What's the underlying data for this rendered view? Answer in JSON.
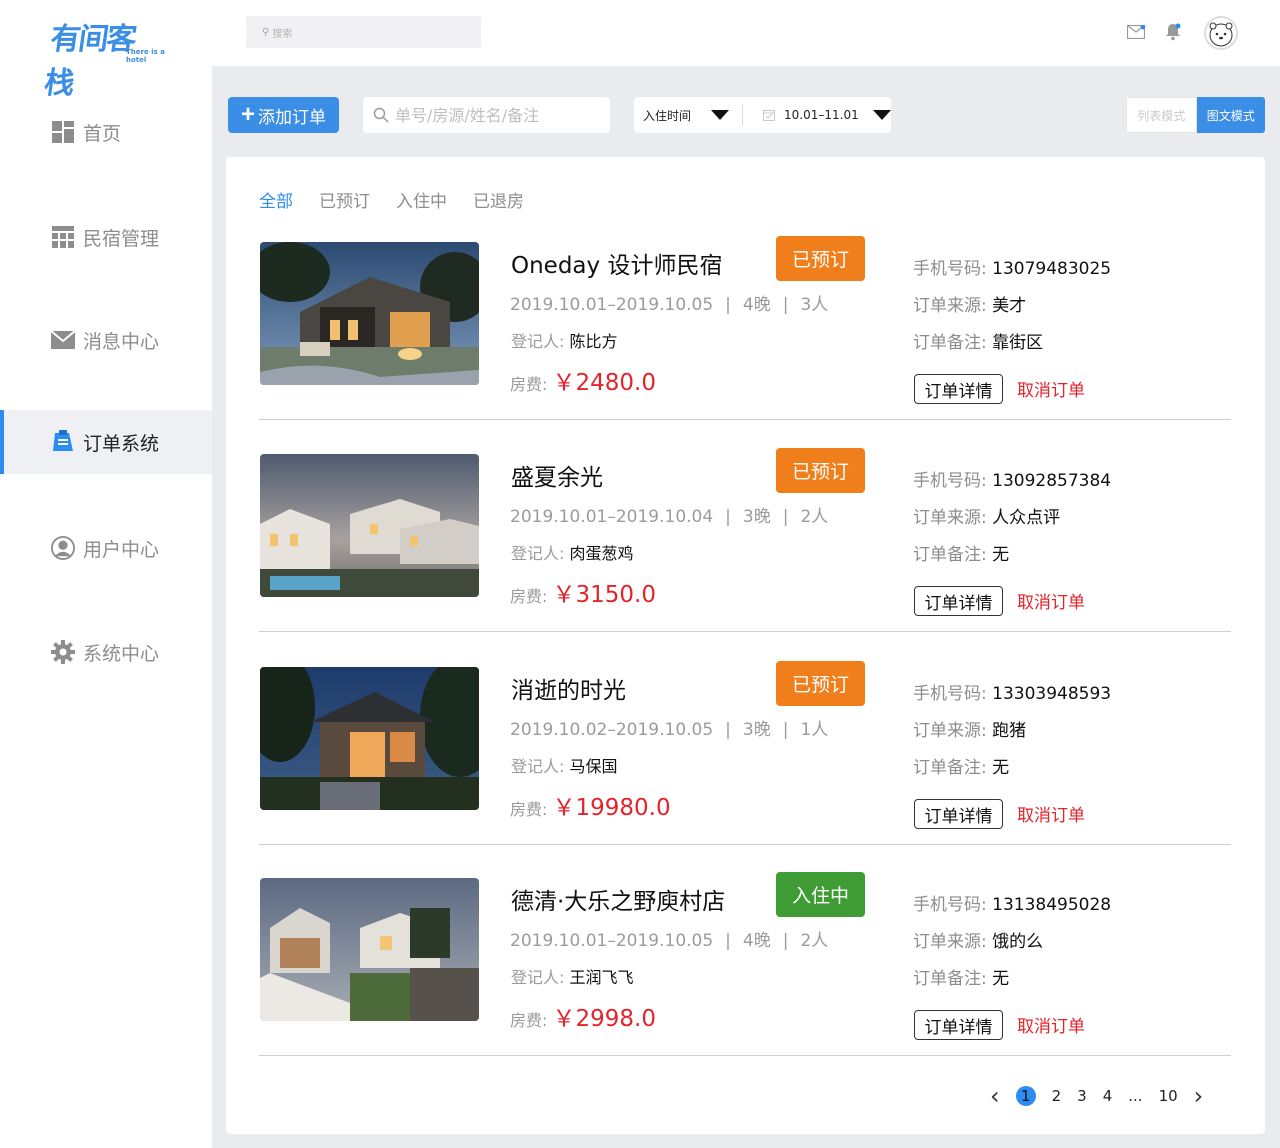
{
  "logo": {
    "main": "有间客栈",
    "sub": "There is a hotel"
  },
  "sidebar": {
    "items": [
      {
        "label": "首页",
        "icon": "dashboard-grid-icon",
        "active": false
      },
      {
        "label": "民宿管理",
        "icon": "table-grid-icon",
        "active": false
      },
      {
        "label": "消息中心",
        "icon": "envelope-icon",
        "active": false
      },
      {
        "label": "订单系统",
        "icon": "order-clipboard-icon",
        "active": true
      },
      {
        "label": "用户中心",
        "icon": "user-circle-icon",
        "active": false
      },
      {
        "label": "系统中心",
        "icon": "gear-icon",
        "active": false
      }
    ]
  },
  "topbar": {
    "search_placeholder": "搜索",
    "icons": [
      "mail-icon",
      "bell-icon",
      "avatar-bear-icon"
    ]
  },
  "toolbar": {
    "add_label": "添加订单",
    "search_placeholder": "单号/房源/姓名/备注",
    "checkin_filter": "入住时间",
    "date_range": "10.01–11.01",
    "mode_list": "列表模式",
    "mode_image": "图文模式"
  },
  "tabs": [
    {
      "label": "全部",
      "active": true
    },
    {
      "label": "已预订",
      "active": false
    },
    {
      "label": "入住中",
      "active": false
    },
    {
      "label": "已退房",
      "active": false
    }
  ],
  "labels": {
    "registrant": "登记人:",
    "fee": "房费:",
    "phone": "手机号码:",
    "source": "订单来源:",
    "remark": "订单备注:",
    "detail_button": "订单详情",
    "cancel_button": "取消订单"
  },
  "orders": [
    {
      "name": "Oneday 设计师民宿",
      "status": "已预订",
      "status_color": "#f07f1b",
      "dates": "2019.10.01–2019.10.05",
      "nights": "4晚",
      "guests": "3人",
      "registrant": "陈比方",
      "price": "￥2480.0",
      "phone": "13079483025",
      "source": "美才",
      "remark": "靠街区"
    },
    {
      "name": "盛夏余光",
      "status": "已预订",
      "status_color": "#f07f1b",
      "dates": "2019.10.01–2019.10.04",
      "nights": "3晚",
      "guests": "2人",
      "registrant": "肉蛋葱鸡",
      "price": "￥3150.0",
      "phone": "13092857384",
      "source": "人众点评",
      "remark": "无"
    },
    {
      "name": "消逝的时光",
      "status": "已预订",
      "status_color": "#f07f1b",
      "dates": "2019.10.02–2019.10.05",
      "nights": "3晚",
      "guests": "1人",
      "registrant": "马保国",
      "price": "￥19980.0",
      "phone": "13303948593",
      "source": "跑猪",
      "remark": "无"
    },
    {
      "name": "德清·大乐之野庾村店",
      "status": "入住中",
      "status_color": "#3f9c35",
      "dates": "2019.10.01–2019.10.05",
      "nights": "4晚",
      "guests": "2人",
      "registrant": "王润飞飞",
      "price": "￥2998.0",
      "phone": "13138495028",
      "source": "饿的么",
      "remark": "无"
    }
  ],
  "pagination": {
    "pages": [
      "1",
      "2",
      "3",
      "4",
      "...",
      "10"
    ],
    "current": "1"
  },
  "colors": {
    "accent": "#3a8ee6",
    "booked": "#f07f1b",
    "checked_in": "#3f9c35",
    "price": "#e4232b"
  }
}
